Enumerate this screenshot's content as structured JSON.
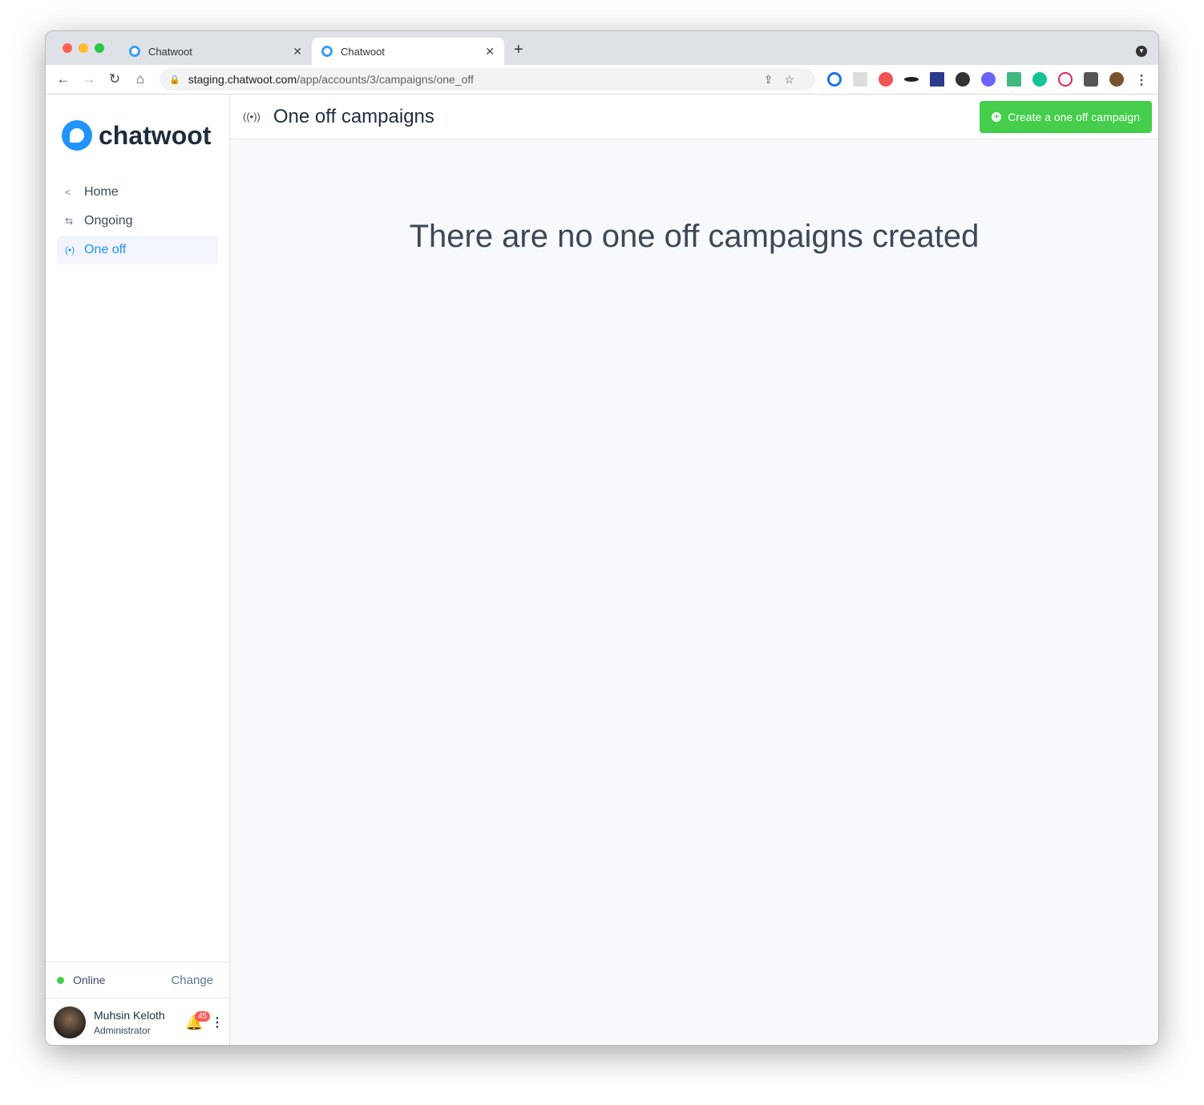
{
  "browser": {
    "tabs": [
      {
        "title": "Chatwoot"
      },
      {
        "title": "Chatwoot"
      }
    ],
    "url_host": "staging.chatwoot.com",
    "url_path": "/app/accounts/3/campaigns/one_off"
  },
  "sidebar": {
    "brand": "chatwoot",
    "items": [
      {
        "label": "Home",
        "icon": "chevron-left-icon"
      },
      {
        "label": "Ongoing",
        "icon": "arrows-swap-icon"
      },
      {
        "label": "One off",
        "icon": "broadcast-icon",
        "active": true
      }
    ],
    "status": {
      "label": "Online",
      "change": "Change",
      "color": "#44ce4b"
    },
    "user": {
      "name": "Muhsin Keloth",
      "role": "Administrator",
      "notifications": "45"
    }
  },
  "header": {
    "title": "One off campaigns",
    "create_button": "Create a one off campaign"
  },
  "main": {
    "empty_message": "There are no one off campaigns created"
  },
  "colors": {
    "accent": "#1f93ff",
    "success": "#44ce4b"
  }
}
